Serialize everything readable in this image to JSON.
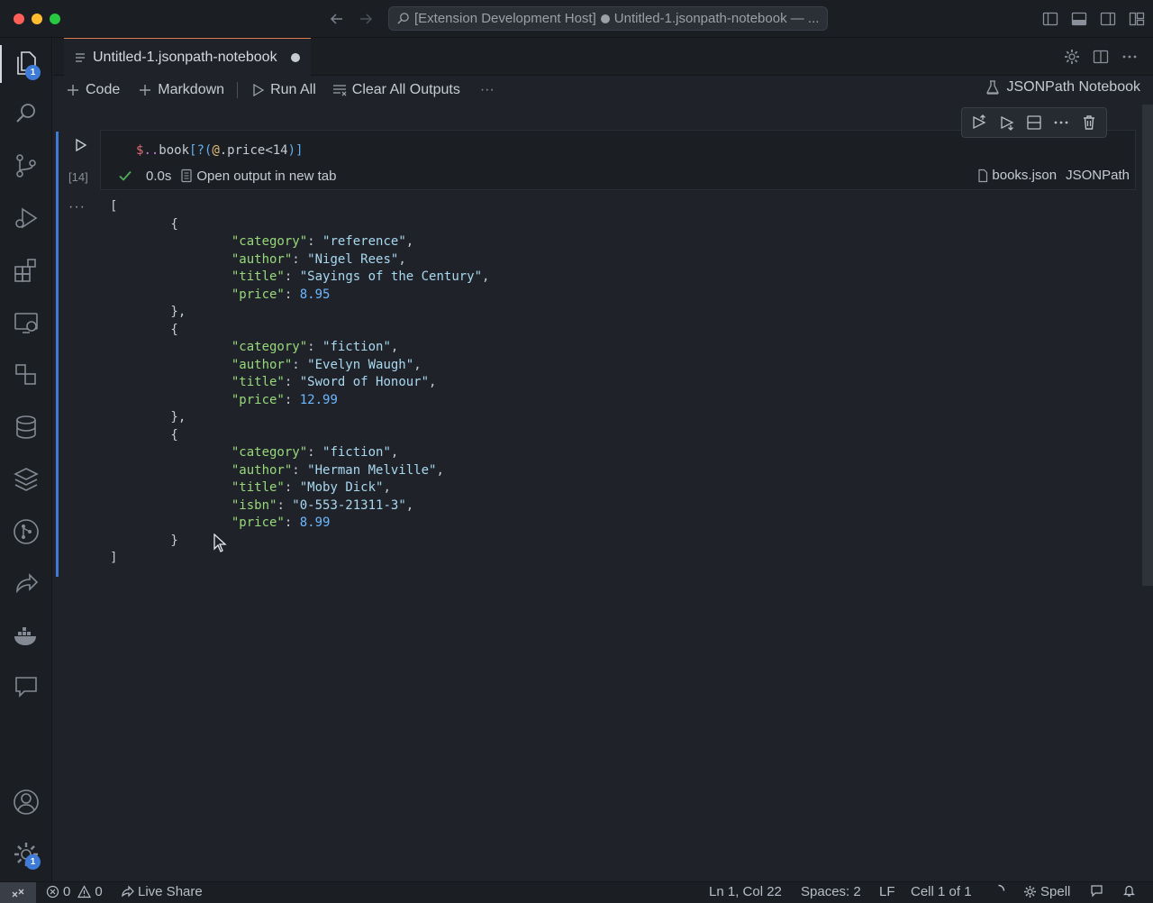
{
  "window": {
    "command_center": "[Extension Development Host]",
    "command_center_file": "Untitled-1.jsonpath-notebook — ..."
  },
  "activity_bar": {
    "explorer_badge": "1",
    "settings_badge": "1"
  },
  "tabs": [
    {
      "label": "Untitled-1.jsonpath-notebook",
      "dirty": true
    }
  ],
  "toolbar": {
    "code_label": "Code",
    "markdown_label": "Markdown",
    "run_all_label": "Run All",
    "clear_outputs_label": "Clear All Outputs",
    "more_label": "···",
    "kernel_label": "JSONPath Notebook"
  },
  "cell": {
    "code": {
      "dollar": "$",
      "dots": "..",
      "name": "book",
      "open": "[?(",
      "at": "@",
      "rest": ".price<14",
      "close": ")]"
    },
    "execution_count": "[14]",
    "duration": "0.0s",
    "open_output_label": "Open output in new tab",
    "source_file": "books.json",
    "language": "JSONPath",
    "output_more": "···"
  },
  "output": {
    "items": [
      {
        "category": "reference",
        "author": "Nigel Rees",
        "title": "Sayings of the Century",
        "price": "8.95"
      },
      {
        "category": "fiction",
        "author": "Evelyn Waugh",
        "title": "Sword of Honour",
        "price": "12.99"
      },
      {
        "category": "fiction",
        "author": "Herman Melville",
        "title": "Moby Dick",
        "isbn": "0-553-21311-3",
        "price": "8.99"
      }
    ],
    "keys": {
      "category": "\"category\"",
      "author": "\"author\"",
      "title": "\"title\"",
      "isbn": "\"isbn\"",
      "price": "\"price\""
    }
  },
  "statusbar": {
    "errors": "0",
    "warnings": "0",
    "live_share": "Live Share",
    "position": "Ln 1, Col 22",
    "spaces": "Spaces: 2",
    "eol": "LF",
    "cell": "Cell 1 of 1",
    "spell": "Spell"
  }
}
